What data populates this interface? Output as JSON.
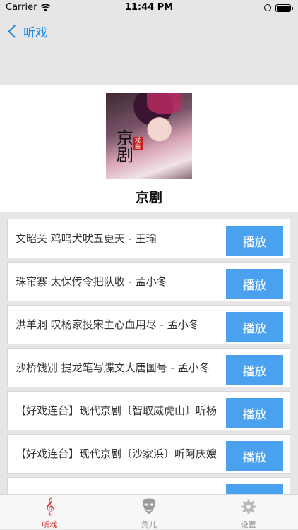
{
  "status_bar": {
    "carrier": "Carrier",
    "time": "11:44 PM",
    "battery_level": 1.0
  },
  "nav": {
    "back_label": "听戏"
  },
  "header": {
    "title": "京剧",
    "cover_text": "京剧",
    "cover_seal": "戏曲"
  },
  "play_label": "播放",
  "items": [
    {
      "title": "文昭关 鸡鸣犬吠五更天 - 王瑜"
    },
    {
      "title": "珠帘寨 太保传令把队收 - 孟小冬"
    },
    {
      "title": "洪羊洞 叹杨家投宋主心血用尽 - 孟小冬"
    },
    {
      "title": "沙桥饯别 提龙笔写牒文大唐国号 - 孟小冬"
    },
    {
      "title": "【好戏连台】现代京剧〔智取威虎山〕听杨"
    },
    {
      "title": "【好戏连台】现代京剧〔沙家浜〕听阿庆嫂"
    },
    {
      "title": ""
    }
  ],
  "tabs": [
    {
      "label": "听戏",
      "icon": "treble-clef-icon",
      "active": true
    },
    {
      "label": "角儿",
      "icon": "opera-mask-icon",
      "active": false
    },
    {
      "label": "设置",
      "icon": "gear-icon",
      "active": false
    }
  ],
  "colors": {
    "accent": "#1e88e5",
    "button": "#4aa1f0",
    "active_tab": "#d32f2f"
  }
}
